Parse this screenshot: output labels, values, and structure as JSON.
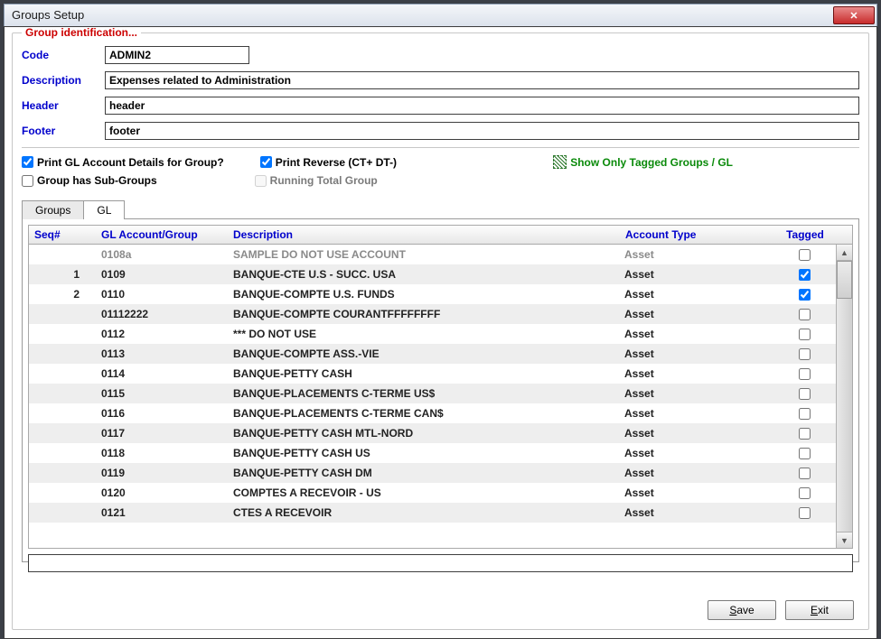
{
  "window": {
    "title": "Groups Setup"
  },
  "section": {
    "legend": "Group identification..."
  },
  "labels": {
    "code": "Code",
    "description": "Description",
    "header": "Header",
    "footer": "Footer",
    "printDetails": "Print GL Account Details for Group?",
    "printReverse": "Print Reverse (CT+ DT-)",
    "showTagged": "Show Only Tagged Groups / GL",
    "hasSubGroups": "Group has Sub-Groups",
    "runningTotal": "Running Total Group"
  },
  "values": {
    "code": "ADMIN2",
    "description": "Expenses related to Administration",
    "header": "header",
    "footer": "footer"
  },
  "checks": {
    "printDetails": true,
    "printReverse": true,
    "showTagged": false,
    "hasSubGroups": false,
    "runningTotal": false
  },
  "tabs": {
    "groups": "Groups",
    "gl": "GL"
  },
  "grid": {
    "headers": {
      "seq": "Seq#",
      "acct": "GL Account/Group",
      "desc": "Description",
      "type": "Account Type",
      "tag": "Tagged"
    },
    "rows": [
      {
        "seq": "",
        "acct": "0108a",
        "desc": "SAMPLE DO NOT USE ACCOUNT",
        "type": "Asset",
        "tagged": false,
        "dim": true
      },
      {
        "seq": "1",
        "acct": "0109",
        "desc": "BANQUE-CTE U.S - SUCC. USA",
        "type": "Asset",
        "tagged": true
      },
      {
        "seq": "2",
        "acct": "0110",
        "desc": "BANQUE-COMPTE U.S. FUNDS",
        "type": "Asset",
        "tagged": true
      },
      {
        "seq": "",
        "acct": "01112222",
        "desc": "BANQUE-COMPTE COURANTFFFFFFFF",
        "type": "Asset",
        "tagged": false
      },
      {
        "seq": "",
        "acct": "0112",
        "desc": "*** DO NOT USE",
        "type": "Asset",
        "tagged": false
      },
      {
        "seq": "",
        "acct": "0113",
        "desc": "BANQUE-COMPTE ASS.-VIE",
        "type": "Asset",
        "tagged": false
      },
      {
        "seq": "",
        "acct": "0114",
        "desc": "BANQUE-PETTY CASH",
        "type": "Asset",
        "tagged": false
      },
      {
        "seq": "",
        "acct": "0115",
        "desc": "BANQUE-PLACEMENTS C-TERME US$",
        "type": "Asset",
        "tagged": false
      },
      {
        "seq": "",
        "acct": "0116",
        "desc": "BANQUE-PLACEMENTS C-TERME CAN$",
        "type": "Asset",
        "tagged": false
      },
      {
        "seq": "",
        "acct": "0117",
        "desc": "BANQUE-PETTY CASH MTL-NORD",
        "type": "Asset",
        "tagged": false
      },
      {
        "seq": "",
        "acct": "0118",
        "desc": "BANQUE-PETTY CASH US",
        "type": "Asset",
        "tagged": false
      },
      {
        "seq": "",
        "acct": "0119",
        "desc": "BANQUE-PETTY CASH DM",
        "type": "Asset",
        "tagged": false
      },
      {
        "seq": "",
        "acct": "0120",
        "desc": "COMPTES A RECEVOIR - US",
        "type": "Asset",
        "tagged": false
      },
      {
        "seq": "",
        "acct": "0121",
        "desc": "CTES A RECEVOIR",
        "type": "Asset",
        "tagged": false
      }
    ]
  },
  "buttons": {
    "save": "Save",
    "exit": "Exit"
  }
}
